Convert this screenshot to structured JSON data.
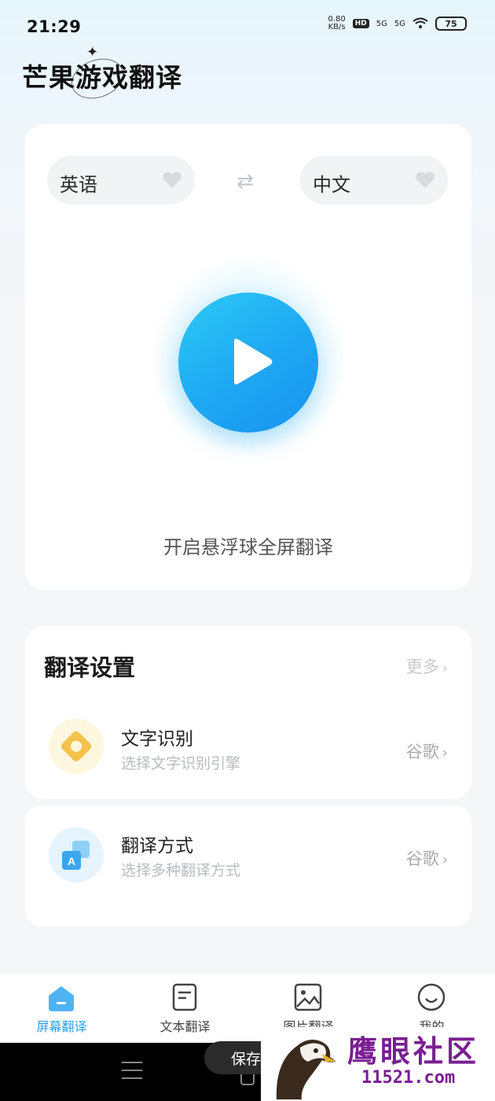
{
  "status_bar": {
    "time": "21:29",
    "net_speed_value": "0.80",
    "net_speed_unit": "KB/s",
    "hd_label": "HD",
    "sig1_label": "5G",
    "sig2_label": "5G",
    "battery": "75"
  },
  "app": {
    "title": "芒果游戏翻译"
  },
  "language": {
    "source": "英语",
    "target": "中文",
    "swap_icon": "swap-arrows-icon"
  },
  "main": {
    "play_icon": "play-icon",
    "caption": "开启悬浮球全屏翻译"
  },
  "settings": {
    "title": "翻译设置",
    "more": "更多",
    "rows": [
      {
        "title": "文字识别",
        "subtitle": "选择文字识别引擎",
        "value": "谷歌",
        "icon": "diamond-icon"
      },
      {
        "title": "翻译方式",
        "subtitle": "选择多种翻译方式",
        "value": "谷歌",
        "icon": "translate-icon"
      }
    ]
  },
  "tabs": [
    {
      "label": "屏幕翻译",
      "icon": "screen-icon",
      "active": true
    },
    {
      "label": "文本翻译",
      "icon": "text-doc-icon",
      "active": false
    },
    {
      "label": "图片翻译",
      "icon": "image-icon",
      "active": false
    },
    {
      "label": "我的",
      "icon": "profile-icon",
      "active": false
    }
  ],
  "toast": {
    "text": "保存"
  },
  "watermark": {
    "text": "鹰眼社区",
    "url": "11521.com"
  },
  "colors": {
    "accent": "#2aa0ee",
    "play": "#1ea7f3",
    "ocr_icon": "#f5c24a"
  }
}
